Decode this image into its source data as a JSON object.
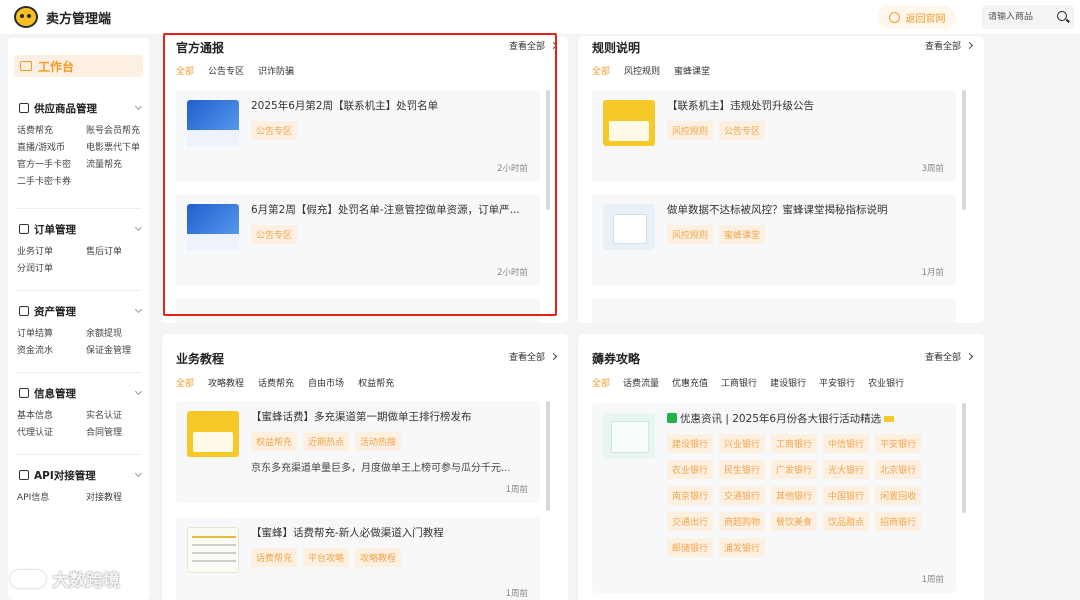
{
  "app": {
    "title": "卖方管理端"
  },
  "header": {
    "back_label": "返回官网",
    "search_placeholder": "请输入商品"
  },
  "sidebar": {
    "workbench": "工作台",
    "groups": [
      {
        "title": "供应商品管理",
        "items": [
          "话费帮充",
          "账号会员帮充",
          "直播/游戏币",
          "电影票代下单",
          "官方一手卡密",
          "流量帮充",
          "二手卡密卡券"
        ]
      },
      {
        "title": "订单管理",
        "items": [
          "业务订单",
          "售后订单",
          "分润订单"
        ]
      },
      {
        "title": "资产管理",
        "items": [
          "订单结算",
          "余额提现",
          "资金流水",
          "保证金管理"
        ]
      },
      {
        "title": "信息管理",
        "items": [
          "基本信息",
          "实名认证",
          "代理认证",
          "合同管理"
        ]
      },
      {
        "title": "API对接管理",
        "items": [
          "API信息",
          "对接教程"
        ]
      }
    ]
  },
  "cards": {
    "official": {
      "title": "官方通报",
      "view_all": "查看全部",
      "tabs": [
        "全部",
        "公告专区",
        "识诈防骗"
      ],
      "items": [
        {
          "title": "2025年6月第2周【联系机主】处罚名单",
          "tags": [
            "公告专区"
          ],
          "time": "2小时前"
        },
        {
          "title": "6月第2周【假充】处罚名单-注意管控做单资源，订单严...",
          "tags": [
            "公告专区"
          ],
          "time": "2小时前"
        }
      ]
    },
    "rules": {
      "title": "规则说明",
      "view_all": "查看全部",
      "tabs": [
        "全部",
        "风控规则",
        "蜜蜂课堂"
      ],
      "items": [
        {
          "title": "【联系机主】违规处罚升级公告",
          "tags": [
            "风控规则",
            "公告专区"
          ],
          "time": "3周前"
        },
        {
          "title": "做单数据不达标被风控？蜜蜂课堂揭秘指标说明",
          "tags": [
            "风控规则",
            "蜜蜂课堂"
          ],
          "time": "1月前"
        }
      ]
    },
    "tutorial": {
      "title": "业务教程",
      "view_all": "查看全部",
      "tabs": [
        "全部",
        "攻略教程",
        "话费帮充",
        "自由市场",
        "权益帮充"
      ],
      "items": [
        {
          "title": "【蜜蜂话费】多充渠道第一期做单王排行榜发布",
          "tags": [
            "权益帮充",
            "近期热点",
            "活动热搜"
          ],
          "desc": "京东多充渠道单量巨多，月度做单王上榜可参与瓜分千元...",
          "time": "1周前"
        },
        {
          "title": "【蜜蜂】话费帮充-新人必做渠道入门教程",
          "tags": [
            "话费帮充",
            "平台攻略",
            "攻略教程"
          ],
          "time": "1周前"
        }
      ]
    },
    "coupons": {
      "title": "薅券攻略",
      "view_all": "查看全部",
      "tabs": [
        "全部",
        "话费流量",
        "优惠充值",
        "工商银行",
        "建设银行",
        "平安银行",
        "农业银行"
      ],
      "items": [
        {
          "title": "优惠资讯 | 2025年6月份各大银行活动精选",
          "tags": [
            "建设银行",
            "兴业银行",
            "工商银行",
            "中信银行",
            "平安银行",
            "农业银行",
            "民生银行",
            "广发银行",
            "光大银行",
            "北京银行",
            "南京银行",
            "交通银行",
            "其他银行",
            "中国银行",
            "闲置回收",
            "交通出行",
            "商超购物",
            "餐饮美食",
            "饮品甜点",
            "招商银行",
            "邮储银行",
            "浦发银行"
          ],
          "time": "1周前"
        }
      ]
    }
  },
  "watermark": "大数跨境"
}
